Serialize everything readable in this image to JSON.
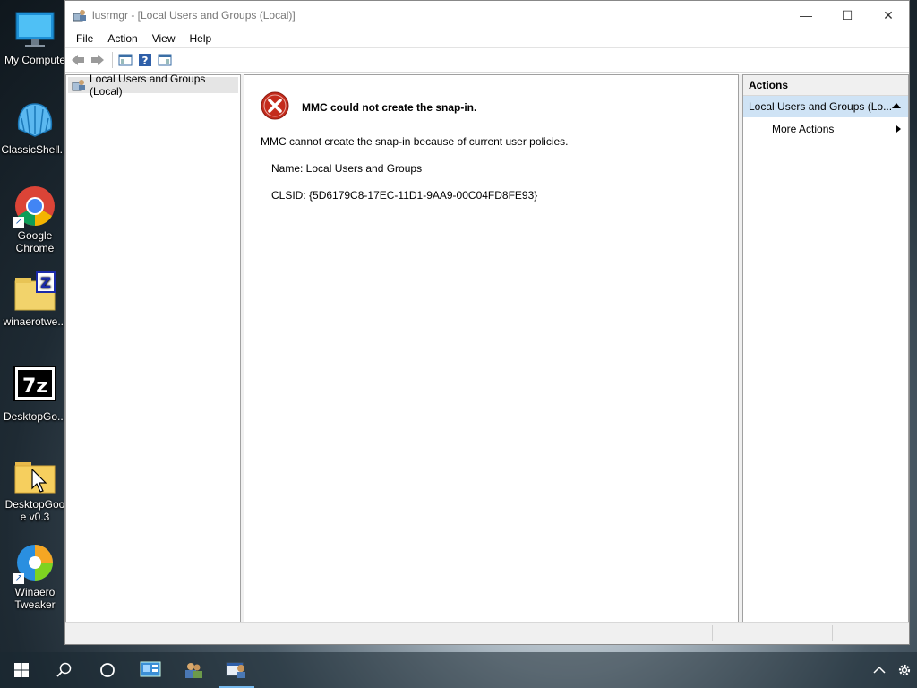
{
  "desktop": {
    "icons": [
      {
        "label": "My Compute",
        "icon": "monitor-icon"
      },
      {
        "label": "ClassicShell...",
        "icon": "shell-icon"
      },
      {
        "label": "Google\nChrome",
        "icon": "chrome-icon"
      },
      {
        "label": "winaerotwe...",
        "icon": "zip-folder-icon"
      },
      {
        "label": "DesktopGo...",
        "icon": "sevenzip-icon"
      },
      {
        "label": "DesktopGoo\ne v0.3",
        "icon": "folder-icon"
      },
      {
        "label": "Winaero\nTweaker",
        "icon": "winaero-icon"
      }
    ]
  },
  "window": {
    "title": "lusrmgr - [Local Users and Groups (Local)]",
    "menu": [
      "File",
      "Action",
      "View",
      "Help"
    ],
    "tree": {
      "root_label": "Local Users and Groups (Local)"
    },
    "content": {
      "error_title": "MMC could not create the snap-in.",
      "message": "MMC cannot create the snap-in because of current user policies.",
      "name_line": "Name: Local Users and Groups",
      "clsid_line": "CLSID: {5D6179C8-17EC-11D1-9AA9-00C04FD8FE93}"
    },
    "actions": {
      "header": "Actions",
      "section_label": "Local Users and Groups (Lo...",
      "more_actions": "More Actions"
    }
  },
  "taskbar": {
    "items": [
      "start-icon",
      "search-icon",
      "cortana-icon",
      "control-panel-icon",
      "users-icon",
      "mmc-icon"
    ]
  }
}
